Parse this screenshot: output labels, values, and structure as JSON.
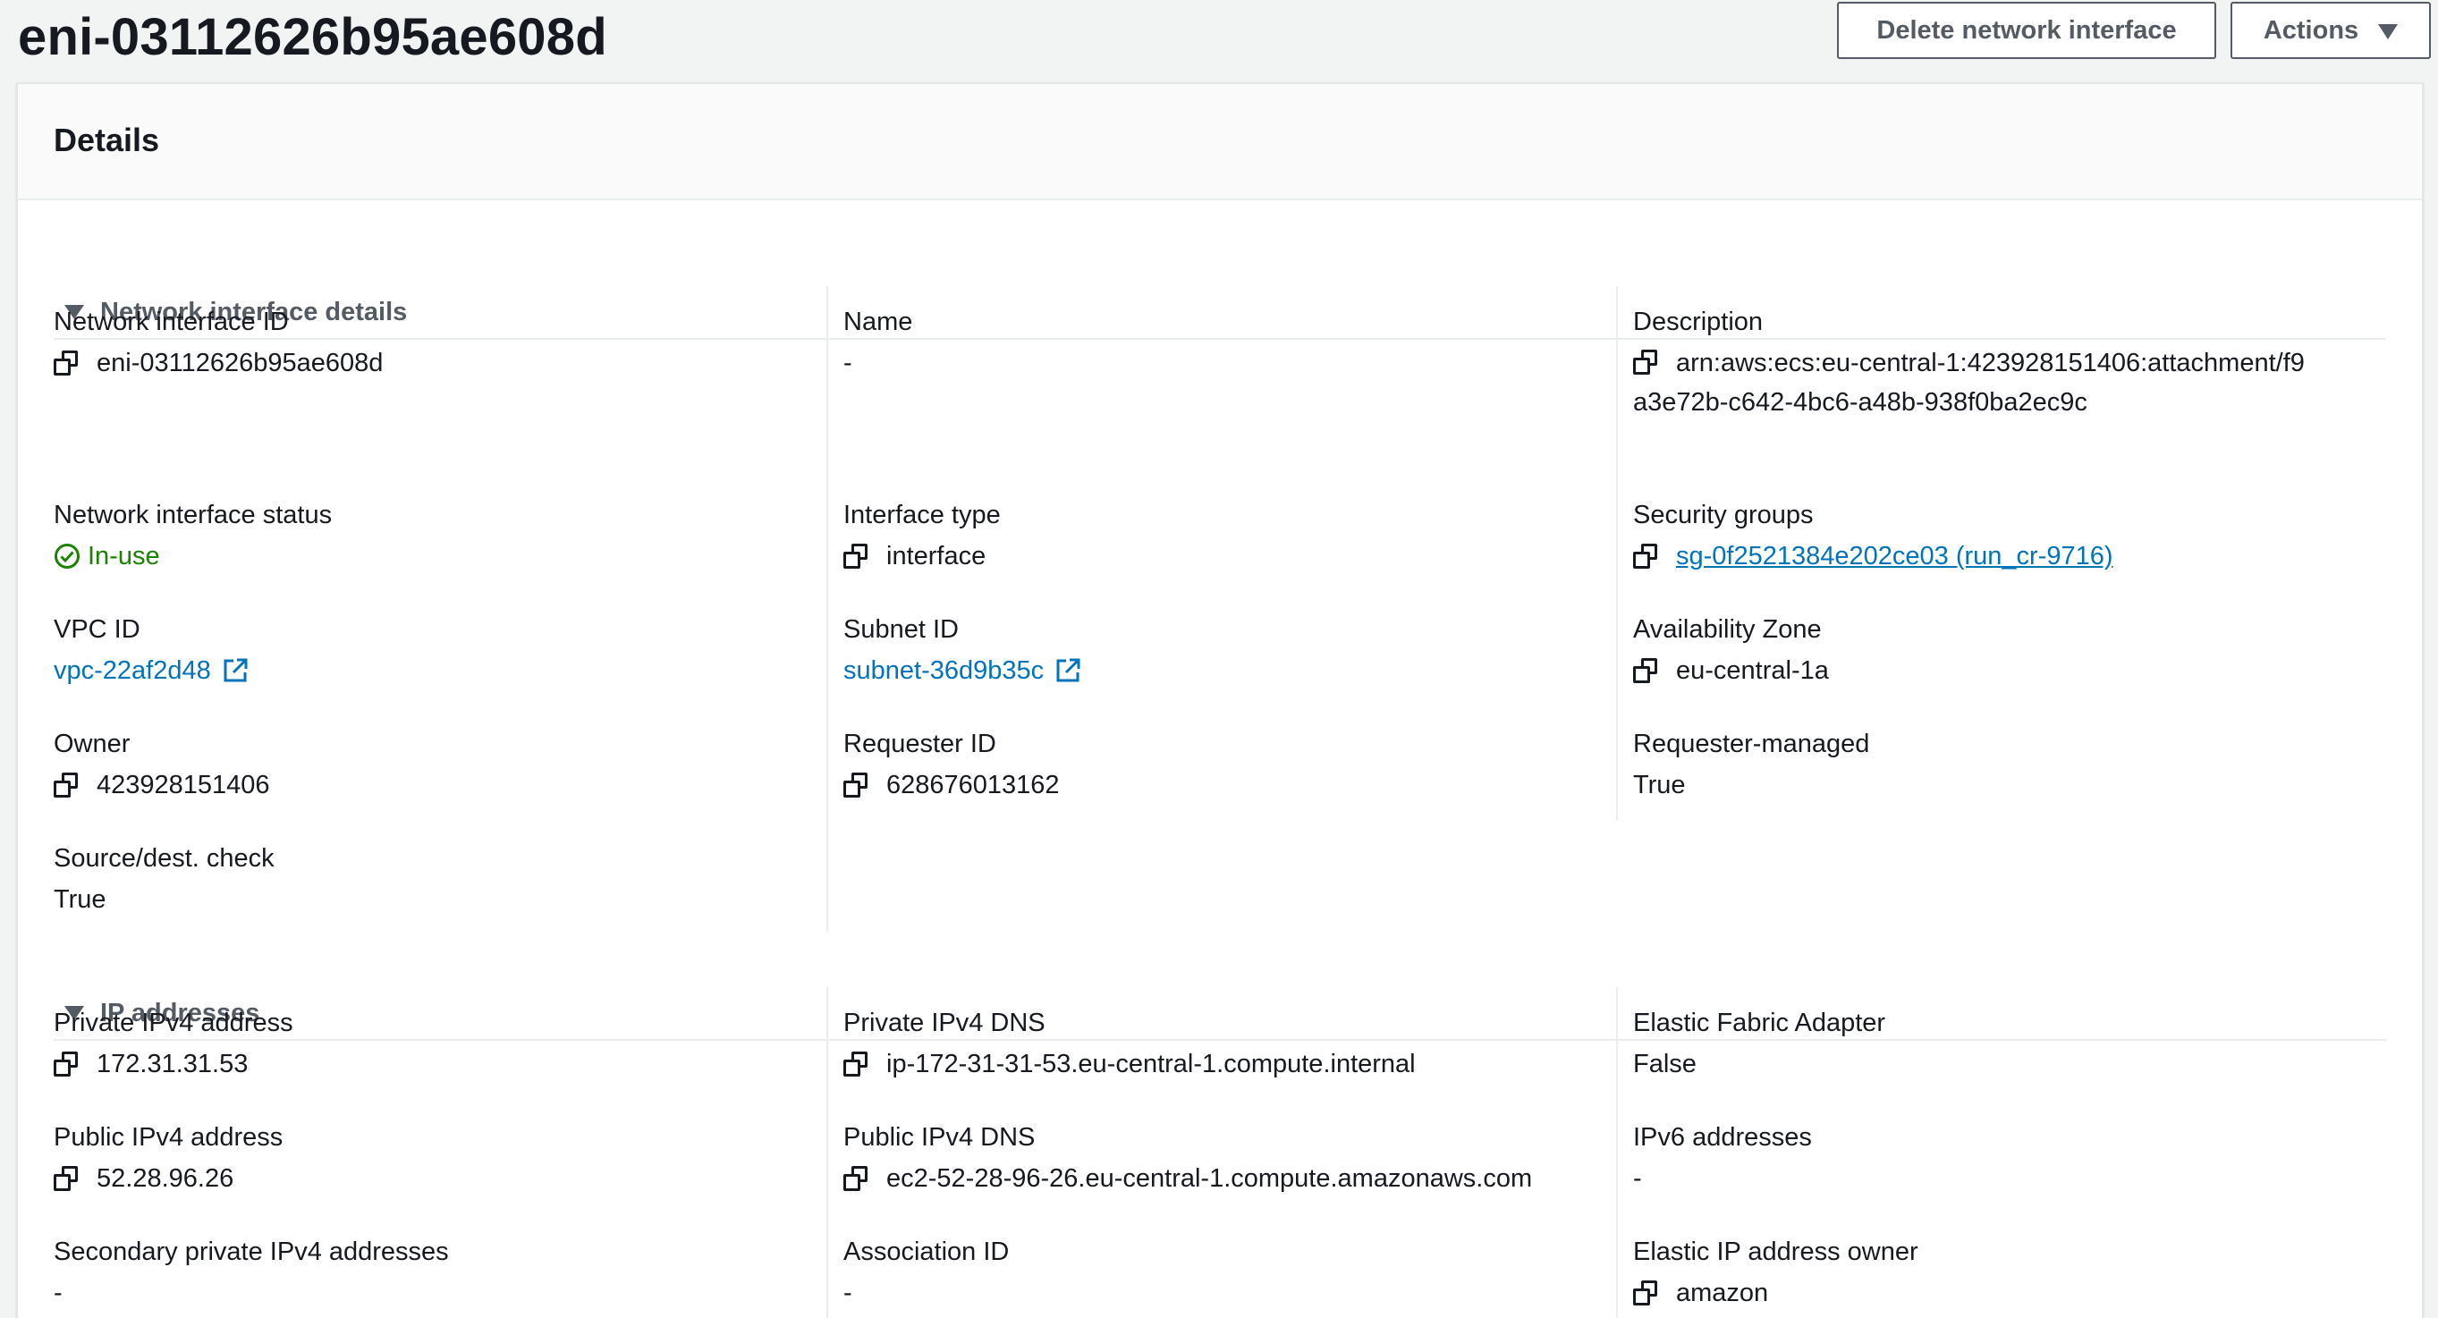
{
  "header": {
    "title": "eni-03112626b95ae608d",
    "delete_button": "Delete network interface",
    "actions_button": "Actions"
  },
  "panel": {
    "title": "Details"
  },
  "sections": {
    "network_interface_details": "Network interface details",
    "ip_addresses": "IP addresses"
  },
  "fields": {
    "eni_id": {
      "label": "Network interface ID",
      "value": "eni-03112626b95ae608d"
    },
    "name": {
      "label": "Name",
      "value": "-"
    },
    "description": {
      "label": "Description",
      "value": "arn:aws:ecs:eu-central-1:423928151406:attachment/f9a3e72b-c642-4bc6-a48b-938f0ba2ec9c"
    },
    "status": {
      "label": "Network interface status",
      "value": "In-use"
    },
    "interface_type": {
      "label": "Interface type",
      "value": "interface"
    },
    "security_groups": {
      "label": "Security groups",
      "value": "sg-0f2521384e202ce03 (run_cr-9716)"
    },
    "vpc_id": {
      "label": "VPC ID",
      "value": "vpc-22af2d48"
    },
    "subnet_id": {
      "label": "Subnet ID",
      "value": "subnet-36d9b35c"
    },
    "availability_zone": {
      "label": "Availability Zone",
      "value": "eu-central-1a"
    },
    "owner": {
      "label": "Owner",
      "value": "423928151406"
    },
    "requester_id": {
      "label": "Requester ID",
      "value": "628676013162"
    },
    "requester_managed": {
      "label": "Requester-managed",
      "value": "True"
    },
    "source_dest_check": {
      "label": "Source/dest. check",
      "value": "True"
    },
    "private_ipv4": {
      "label": "Private IPv4 address",
      "value": "172.31.31.53"
    },
    "private_ipv4_dns": {
      "label": "Private IPv4 DNS",
      "value": "ip-172-31-31-53.eu-central-1.compute.internal"
    },
    "efa": {
      "label": "Elastic Fabric Adapter",
      "value": "False"
    },
    "public_ipv4": {
      "label": "Public IPv4 address",
      "value": "52.28.96.26"
    },
    "public_ipv4_dns": {
      "label": "Public IPv4 DNS",
      "value": "ec2-52-28-96-26.eu-central-1.compute.amazonaws.com"
    },
    "ipv6": {
      "label": "IPv6 addresses",
      "value": "-"
    },
    "secondary_private_ipv4": {
      "label": "Secondary private IPv4 addresses",
      "value": "-"
    },
    "association_id": {
      "label": "Association ID",
      "value": "-"
    },
    "eip_owner": {
      "label": "Elastic IP address owner",
      "value": "amazon"
    }
  },
  "icons": {
    "copy": "copy-icon",
    "external": "external-link-icon",
    "status_ok": "check-circle-icon",
    "expand": "caret-down-icon"
  },
  "colors": {
    "link": "#0073bb",
    "success": "#1d8102",
    "text": "#16191f",
    "muted": "#545b64"
  }
}
